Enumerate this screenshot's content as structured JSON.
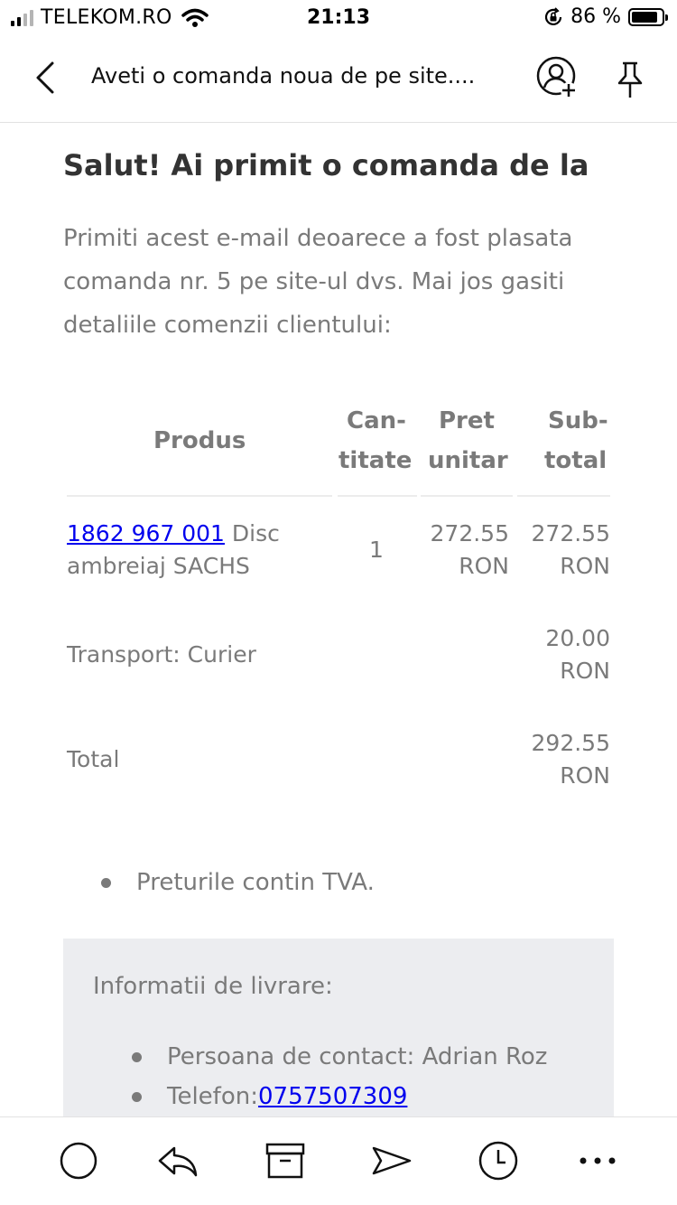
{
  "status_bar": {
    "carrier": "TELEKOM.RO",
    "time": "21:13",
    "battery": "86 %",
    "battery_level": 0.86
  },
  "header": {
    "subject": "Aveti o comanda noua de pe site...."
  },
  "email": {
    "greeting": "Salut! Ai primit o comanda de la",
    "intro": "Primiti acest e-mail deoarece a fost plasata comanda nr. 5 pe site-ul dvs. Mai jos gasiti detaliile comenzii clientului:",
    "table": {
      "headers": {
        "product": "Produs",
        "quantity_1": "Can-",
        "quantity_2": "titate",
        "unit_price_1": "Pret",
        "unit_price_2": "unitar",
        "subtotal_1": "Sub-",
        "subtotal_2": "total"
      },
      "item": {
        "code": "1862 967 001",
        "name_1": "Disc",
        "name_2": "ambreiaj SACHS",
        "quantity": "1",
        "unit_price_value": "272.55",
        "unit_price_currency": "RON",
        "subtotal_value": "272.55",
        "subtotal_currency": "RON"
      },
      "shipping": {
        "label": "Transport: Curier",
        "value": "20.00",
        "currency": "RON"
      },
      "total": {
        "label": "Total",
        "value": "292.55",
        "currency": "RON"
      }
    },
    "notes": [
      "Preturile contin TVA."
    ],
    "delivery": {
      "title": "Informatii de livrare:",
      "contact_label": "Persoana de contact: Adrian Roz",
      "phone_label": "Telefon: ",
      "phone": "0757507309"
    }
  },
  "toolbar": {
    "icons": [
      "circle-icon",
      "reply-icon",
      "archive-icon",
      "forward-icon",
      "clock-icon",
      "more-icon"
    ]
  }
}
